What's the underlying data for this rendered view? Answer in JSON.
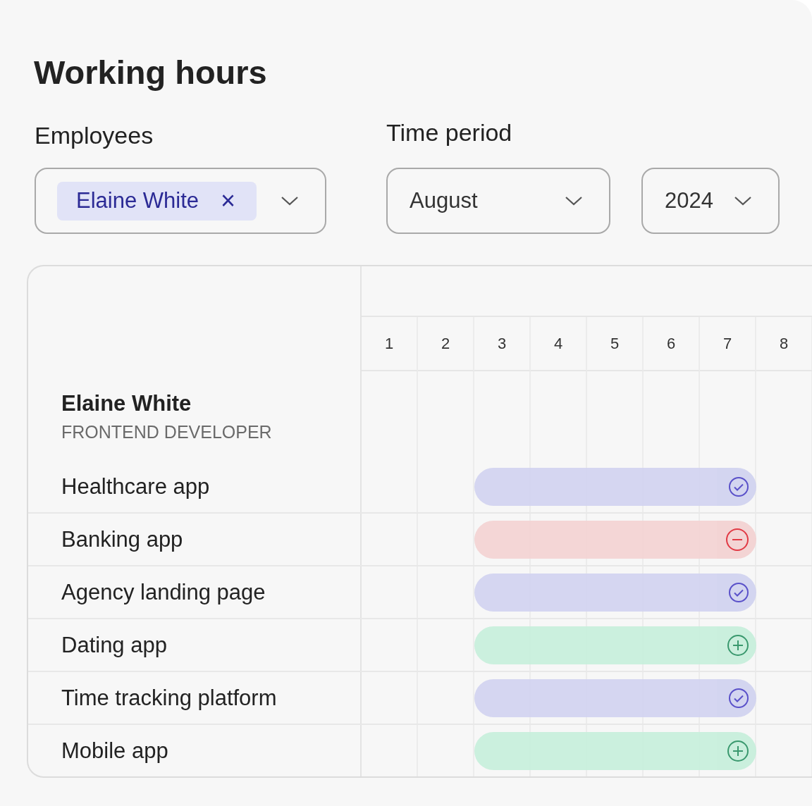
{
  "title": "Working hours",
  "filters": {
    "employees": {
      "label": "Employees",
      "chips": [
        {
          "text": "Elaine White",
          "remove": "×"
        }
      ]
    },
    "time_period": {
      "label": "Time period",
      "month": "August",
      "year": "2024"
    }
  },
  "schedule": {
    "days": [
      "1",
      "2",
      "3",
      "4",
      "5",
      "6",
      "7",
      "8"
    ],
    "employee": {
      "name": "Elaine White",
      "role": "FRONTEND DEVELOPER"
    },
    "projects": [
      {
        "name": "Healthcare app",
        "kind": "done"
      },
      {
        "name": "Banking app",
        "kind": "blocked"
      },
      {
        "name": "Agency landing page",
        "kind": "done"
      },
      {
        "name": "Dating app",
        "kind": "added"
      },
      {
        "name": "Time tracking platform",
        "kind": "done"
      },
      {
        "name": "Mobile app",
        "kind": "added"
      }
    ]
  }
}
